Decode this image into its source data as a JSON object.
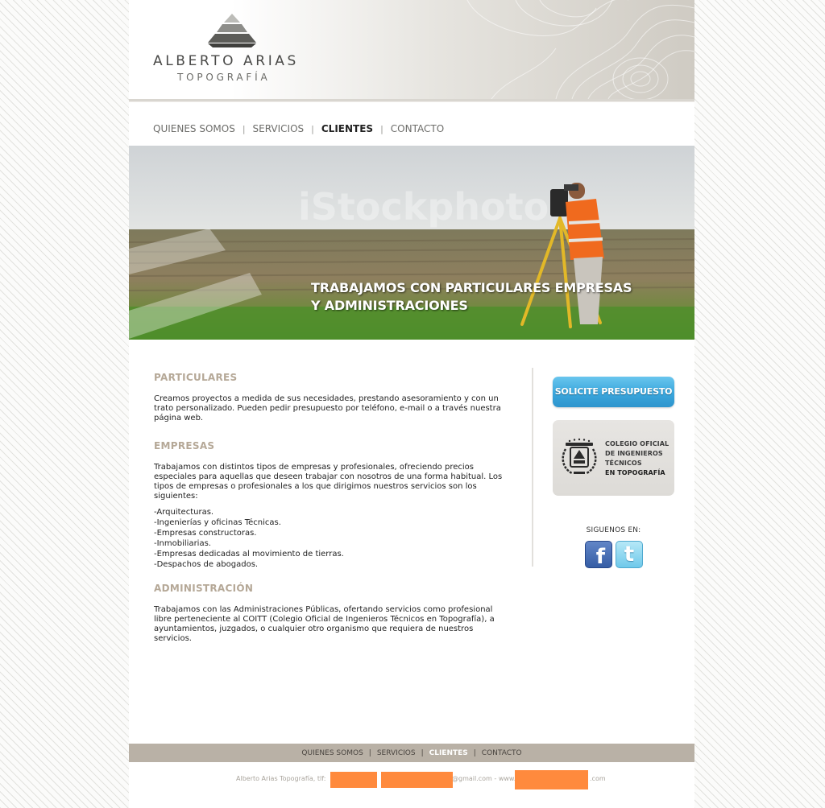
{
  "brand": {
    "name": "ALBERTO ARIAS",
    "subtitle": "TOPOGRAFÍA"
  },
  "nav": {
    "items": [
      {
        "label": "QUIENES SOMOS",
        "active": false
      },
      {
        "label": "SERVICIOS",
        "active": false
      },
      {
        "label": "CLIENTES",
        "active": true
      },
      {
        "label": "CONTACTO",
        "active": false
      }
    ],
    "separator": "|"
  },
  "hero": {
    "title_line1": "TRABAJAMOS CON PARTICULARES EMPRESAS",
    "title_line2": "Y ADMINISTRACIONES",
    "watermark": "iStockphoto"
  },
  "sections": {
    "particulares": {
      "title": "PARTICULARES",
      "text": "Creamos proyectos a medida de sus necesidades, prestando asesoramiento y con un trato personalizado. Pueden pedir presupuesto por  teléfono, e-mail o a través nuestra página web."
    },
    "empresas": {
      "title": "EMPRESAS",
      "text": "Trabajamos con distintos tipos de empresas y profesionales, ofreciendo precios especiales para aquellas que deseen trabajar con nosotros de una forma habitual. Los tipos de empresas o profesionales a los que dirigimos nuestros servicios son los siguientes:",
      "list": [
        "-Arquitecturas.",
        "-Ingenierías y oficinas Técnicas.",
        "-Empresas constructoras.",
        "-Inmobiliarias.",
        "-Empresas dedicadas al movimiento de tierras.",
        "-Despachos de abogados."
      ]
    },
    "administracion": {
      "title": "ADMINISTRACIÓN",
      "text": "Trabajamos con las Administraciones Públicas, ofertando servicios como profesional libre perteneciente al COITT (Colegio Oficial de Ingenieros Técnicos en Topografía), a ayuntamientos, juzgados, o cualquier otro organismo que requiera de nuestros servicios."
    }
  },
  "sidebar": {
    "quote_button": "SOLICITE PRESUPUESTO",
    "coitt_lines": [
      "COLEGIO OFICIAL",
      "DE INGENIEROS",
      "TÉCNICOS",
      "EN TOPOGRAFÍA"
    ],
    "follow_label": "SIGUENOS EN:",
    "social": [
      {
        "name": "facebook",
        "glyph": "f",
        "color": "#3b5998"
      },
      {
        "name": "twitter",
        "glyph": "t",
        "color": "#55c4ea"
      }
    ]
  },
  "footer": {
    "nav": [
      {
        "label": "QUIENES SOMOS",
        "active": false
      },
      {
        "label": "SERVICIOS",
        "active": false
      },
      {
        "label": "CLIENTES",
        "active": true
      },
      {
        "label": "CONTACTO",
        "active": false
      }
    ],
    "info_prefix": "Alberto Arias Topografía,  tlf:",
    "email_suffix": "@gmail.com - www.",
    "web_suffix": ".com"
  },
  "colors": {
    "accent_blue": "#3aa6dc",
    "section_title": "#b5a897",
    "footer_bar": "#b9b1a6",
    "redaction": "#ff8a3d"
  }
}
